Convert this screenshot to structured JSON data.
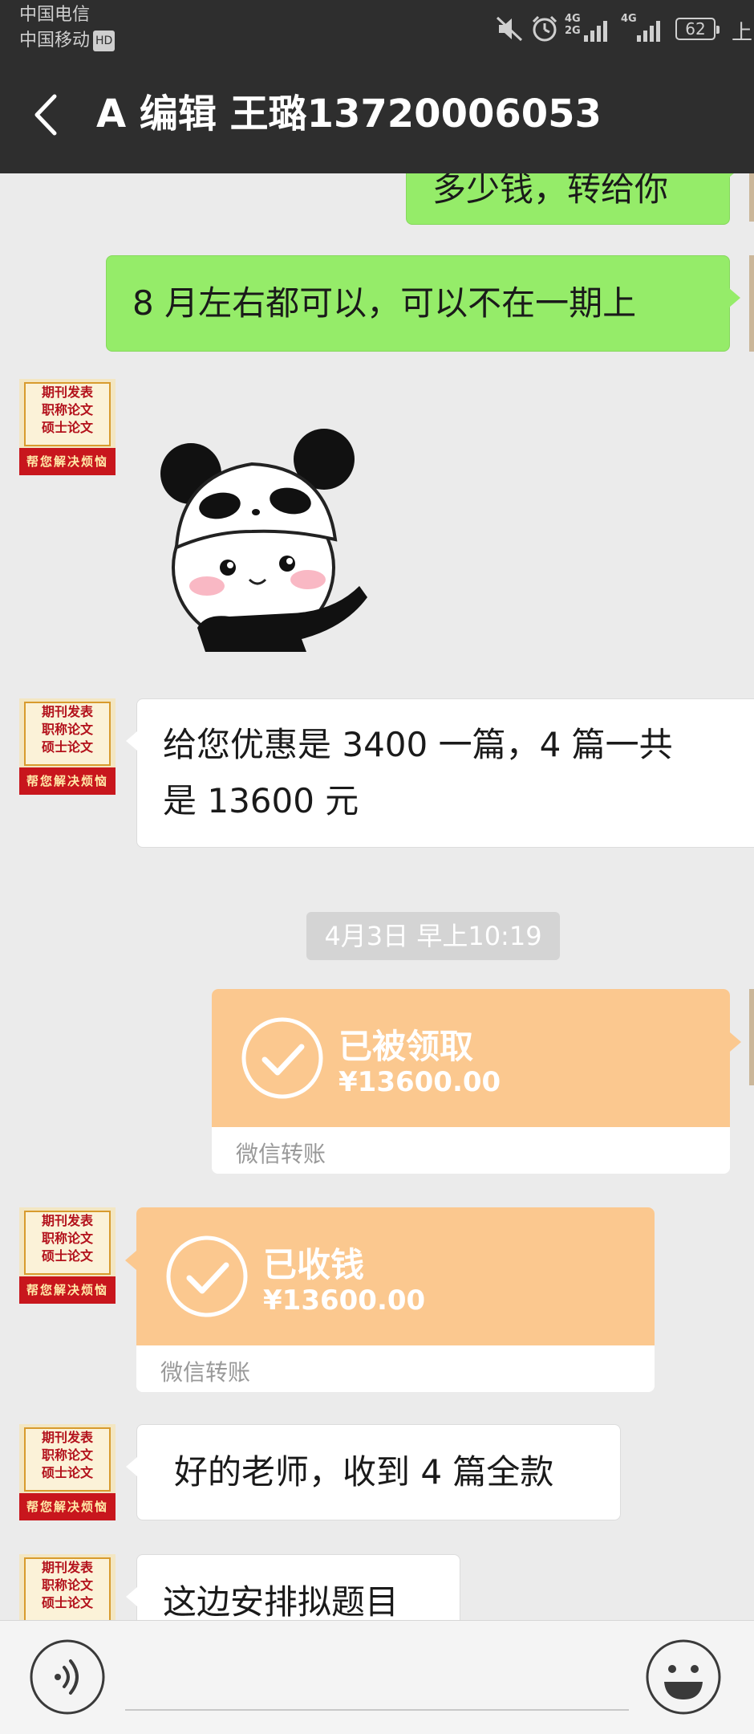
{
  "status_bar": {
    "carrier_1": "中国电信",
    "carrier_2": "中国移动",
    "hd_badge": "HD",
    "net_1": "4G",
    "net_1b": "2G",
    "net_2": "4G",
    "battery": "62",
    "clock_partial": "上",
    "icons": [
      "mute-icon",
      "alarm-icon",
      "signal-icon",
      "signal-icon",
      "battery-icon"
    ]
  },
  "nav": {
    "title": "A 编辑  王璐13720006053",
    "back_icon": "chevron-left-icon"
  },
  "avatar_text": {
    "line1": "期刊发表",
    "line2": "职称论文",
    "line3": "硕士论文",
    "banner": "帮您解决烦恼"
  },
  "messages": {
    "m1": "多少钱，转给你",
    "m2": "8 月左右都可以，可以不在一期上",
    "m3_sticker": "panda-sticker",
    "m4_line1": "给您优惠是 3400 一篇，4 篇一共",
    "m4_line2": "是 13600 元",
    "timestamp": "4月3日 早上10:19",
    "transfer_out": {
      "status": "已被领取",
      "amount": "¥13600.00",
      "source": "微信转账"
    },
    "transfer_in": {
      "status": "已收钱",
      "amount": "¥13600.00",
      "source": "微信转账"
    },
    "m7": "好的老师，收到 4 篇全款",
    "m8": "这边安排拟题目"
  },
  "input_bar": {
    "voice_icon": "voice-icon",
    "emoji_icon": "emoji-icon",
    "text_value": ""
  },
  "colors": {
    "nav_bg": "#2e2e2e",
    "chat_bg": "#ebebeb",
    "self_bubble": "#95ec69",
    "other_bubble": "#ffffff",
    "transfer_orange": "#fbc88f"
  }
}
